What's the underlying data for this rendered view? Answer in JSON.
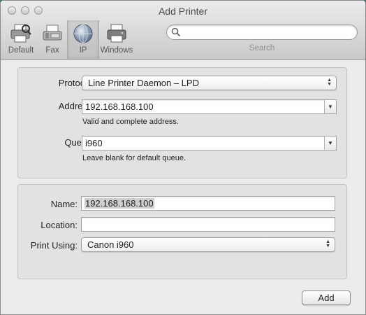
{
  "window": {
    "title": "Add Printer"
  },
  "toolbar": {
    "items": [
      {
        "label": "Default",
        "icon": "default-printer-icon"
      },
      {
        "label": "Fax",
        "icon": "fax-icon"
      },
      {
        "label": "IP",
        "icon": "ip-globe-icon",
        "selected": true
      },
      {
        "label": "Windows",
        "icon": "windows-printer-icon"
      }
    ],
    "search": {
      "label": "Search",
      "placeholder": "",
      "value": ""
    }
  },
  "connection": {
    "protocol_label": "Protocol:",
    "protocol_value": "Line Printer Daemon – LPD",
    "address_label": "Address:",
    "address_value": "192.168.168.100",
    "address_hint": "Valid and complete address.",
    "queue_label": "Queue:",
    "queue_value": "i960",
    "queue_hint": "Leave blank for default queue."
  },
  "details": {
    "name_label": "Name:",
    "name_value": "192.168.168.100",
    "location_label": "Location:",
    "location_value": "",
    "print_using_label": "Print Using:",
    "print_using_value": "Canon i960"
  },
  "actions": {
    "add_label": "Add"
  }
}
